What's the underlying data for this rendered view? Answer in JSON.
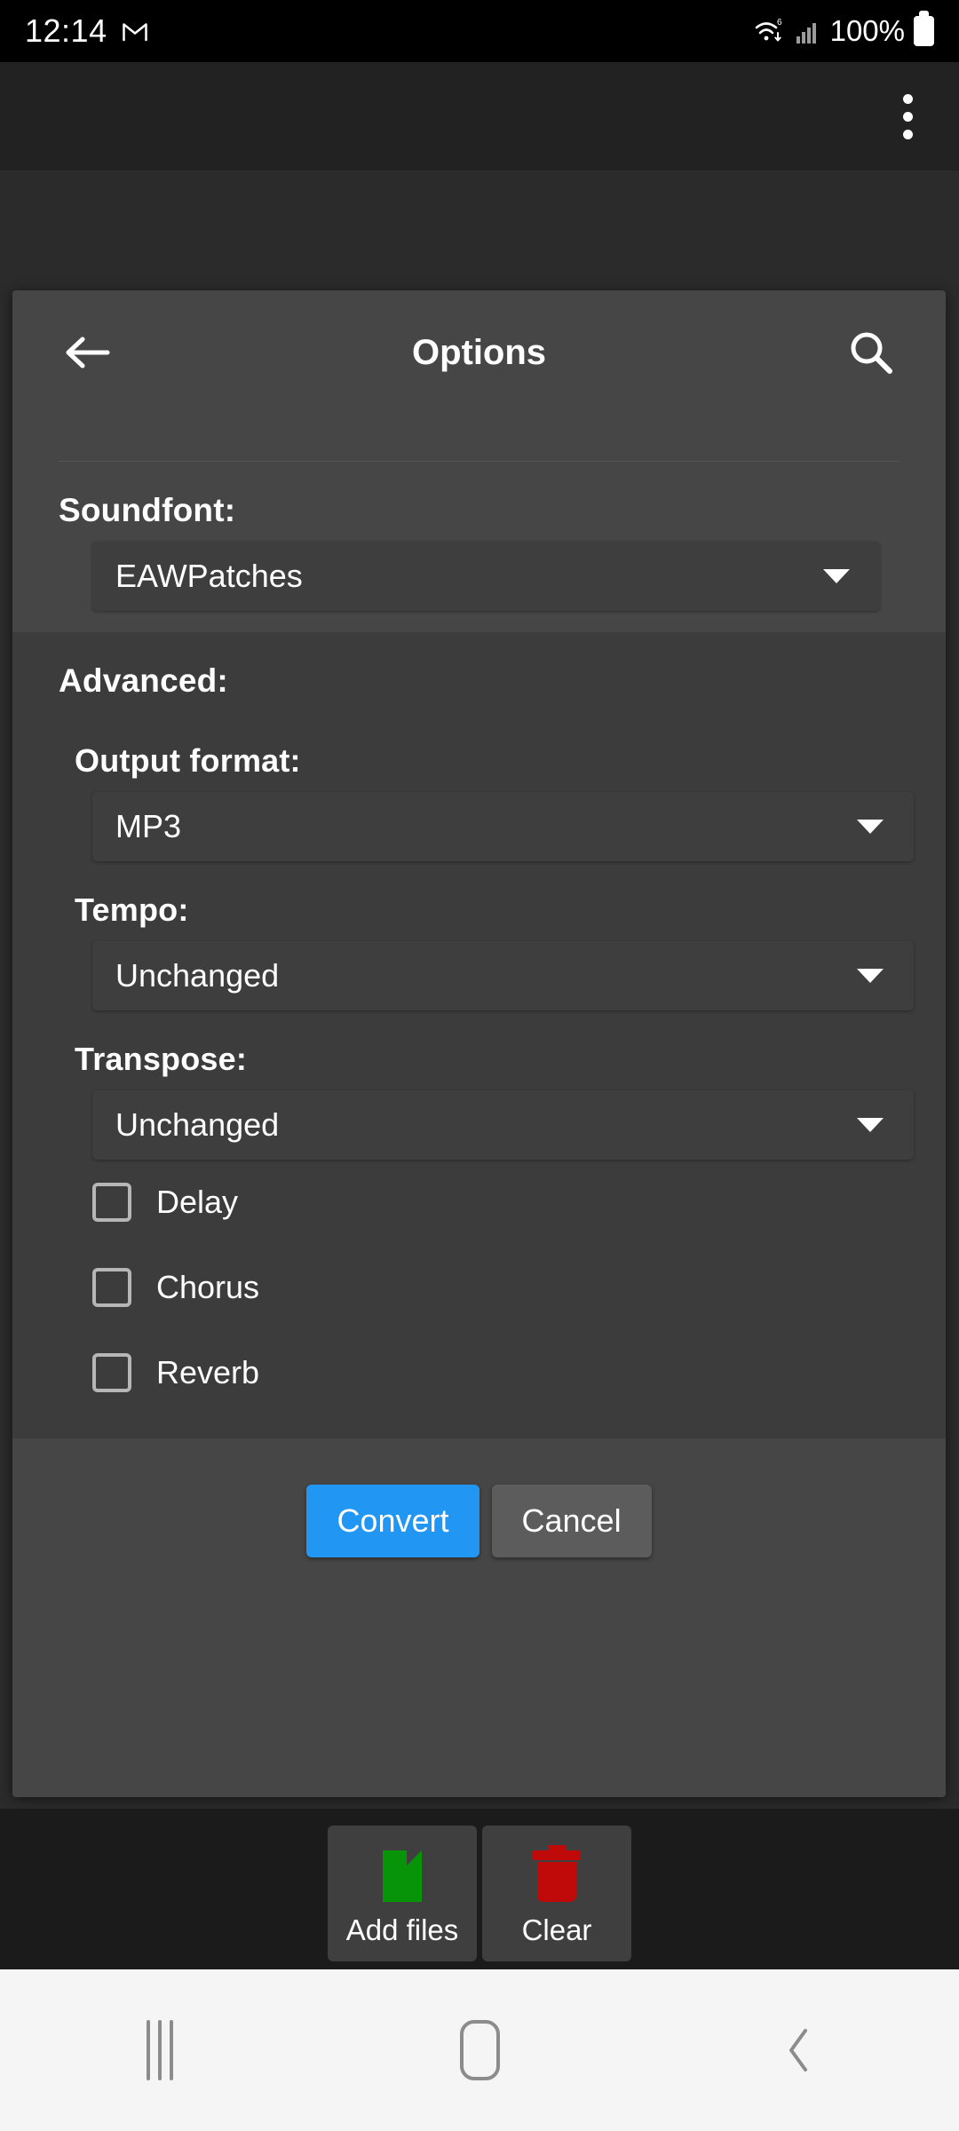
{
  "status_bar": {
    "time": "12:14",
    "notification_icon": "gmail-icon",
    "wifi_icon": "wifi-6-icon",
    "signal_icon": "cellular-signal-icon",
    "battery_percent": "100%",
    "battery_icon": "battery-full-icon"
  },
  "app_bar": {
    "overflow_icon": "more-vertical-icon"
  },
  "dialog": {
    "title": "Options",
    "back_icon": "arrow-left-icon",
    "search_icon": "search-icon",
    "soundfont": {
      "label": "Soundfont:",
      "value": "EAWPatches",
      "caret_icon": "chevron-down-icon"
    },
    "advanced": {
      "label": "Advanced:",
      "output_format": {
        "label": "Output format:",
        "value": "MP3",
        "caret_icon": "chevron-down-icon"
      },
      "tempo": {
        "label": "Tempo:",
        "value": "Unchanged",
        "caret_icon": "chevron-down-icon"
      },
      "transpose": {
        "label": "Transpose:",
        "value": "Unchanged",
        "caret_icon": "chevron-down-icon"
      },
      "effects": [
        {
          "label": "Delay",
          "checked": false
        },
        {
          "label": "Chorus",
          "checked": false
        },
        {
          "label": "Reverb",
          "checked": false
        }
      ]
    },
    "buttons": {
      "convert": "Convert",
      "cancel": "Cancel"
    }
  },
  "toolbar": {
    "add_files": {
      "label": "Add files",
      "icon": "file-document-icon"
    },
    "clear": {
      "label": "Clear",
      "icon": "trash-icon"
    }
  },
  "navigation_bar": {
    "recents_icon": "recents-icon",
    "home_icon": "home-icon",
    "back_icon": "back-chevron-icon"
  },
  "colors": {
    "accent": "#2196f3",
    "dialog_bg": "#464646",
    "advanced_bg": "#3c3c3c",
    "spinner_bg": "#3e3e3e",
    "add_files_icon": "#089408",
    "clear_icon": "#c00a0a"
  }
}
